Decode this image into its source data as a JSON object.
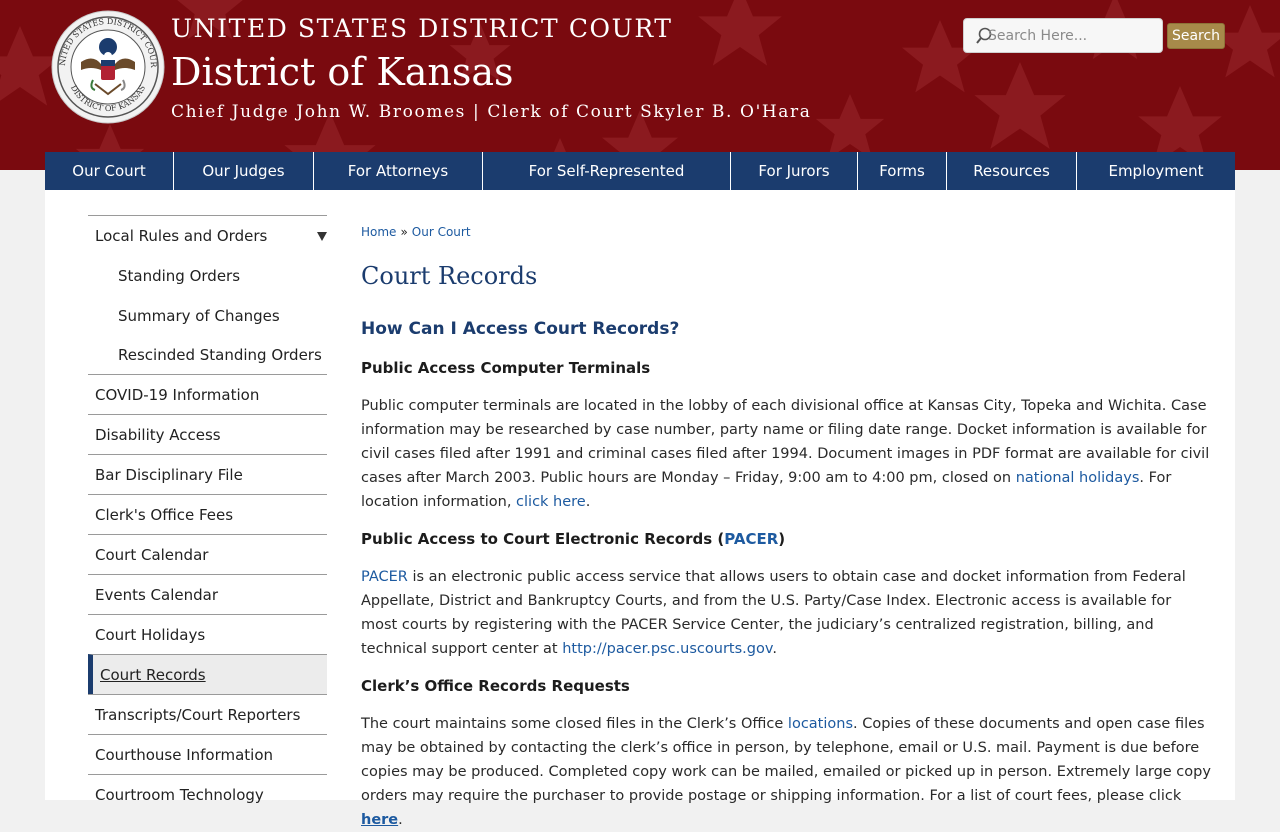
{
  "header": {
    "court_title": "UNITED STATES DISTRICT COURT",
    "district_title": "District of Kansas",
    "judges_line": "Chief Judge John W. Broomes | Clerk of Court Skyler B. O'Hara",
    "seal_icon": "court-seal-logo",
    "search": {
      "placeholder": "Search Here...",
      "button_label": "Search"
    },
    "colors": {
      "banner": "#7a0a0f",
      "search_button": "#a78a4a"
    }
  },
  "nav": {
    "items": [
      {
        "label": "Our Court"
      },
      {
        "label": "Our Judges"
      },
      {
        "label": "For Attorneys"
      },
      {
        "label": "For Self-Represented"
      },
      {
        "label": "For Jurors"
      },
      {
        "label": "Forms"
      },
      {
        "label": "Resources"
      },
      {
        "label": "Employment"
      }
    ],
    "color": "#1b3c6e"
  },
  "sidebar": {
    "items": [
      {
        "label": "Local Rules and Orders"
      },
      {
        "label": "Standing Orders"
      },
      {
        "label": "Summary of Changes"
      },
      {
        "label": "Rescinded Standing Orders"
      },
      {
        "label": "COVID-19 Information"
      },
      {
        "label": "Disability Access"
      },
      {
        "label": "Bar Disciplinary File"
      },
      {
        "label": "Clerk's Office Fees"
      },
      {
        "label": "Court Calendar"
      },
      {
        "label": "Events Calendar"
      },
      {
        "label": "Court Holidays"
      },
      {
        "label": "Court Records"
      },
      {
        "label": "Transcripts/Court Reporters"
      },
      {
        "label": "Courthouse Information"
      },
      {
        "label": "Courtroom Technology"
      }
    ],
    "active": "Court Records"
  },
  "main": {
    "breadcrumb": {
      "home": "Home",
      "separator": "»",
      "current": "Our Court"
    },
    "title": "Court Records",
    "section_heading": "How Can I Access Court Records?",
    "terminals": {
      "heading": "Public Access Computer Terminals",
      "text1": "Public computer terminals are located in the lobby of each divisional office at Kansas City, Topeka and Wichita.  Case information may be researched by case number, party name or filing date range.  Docket information is available for civil cases filed after 1991 and criminal cases filed after 1994.  Document images in PDF format are available for civil cases after March 2003.  Public hours are Monday – Friday, 9:00 am to 4:00 pm, closed on ",
      "link1": "national holidays",
      "text2": ".  For location information, ",
      "link2": "click here",
      "text3": "."
    },
    "pacer": {
      "heading_text": "Public Access to Court Electronic Records (",
      "heading_link": "PACER",
      "heading_close": ")",
      "link1": "PACER",
      "text1": " is an electronic public access service that allows users to obtain case and docket information from Federal Appellate, District and Bankruptcy Courts, and from the U.S. Party/Case Index. Electronic access is available for most courts by registering with the PACER Service Center, the judiciary’s centralized registration, billing, and technical support center at ",
      "link2": "http://pacer.psc.uscourts.gov",
      "text2": "."
    },
    "requests": {
      "heading": "Clerk’s Office Records Requests",
      "text1": "The court maintains some closed files in the Clerk’s Office ",
      "link1": "locations",
      "text2": ". Copies of these documents and open case files may be obtained by contacting the clerk’s office in person, by telephone, email or U.S. mail. Payment is due before copies may be produced.  Completed copy work can be mailed, emailed or picked up in person. Extremely large copy orders may require the purchaser to provide postage or shipping information. For a list of court fees, please click ",
      "link2": "here",
      "text3": "."
    },
    "link_color": "#1d5aa0",
    "heading_color": "#1b3c6e"
  }
}
